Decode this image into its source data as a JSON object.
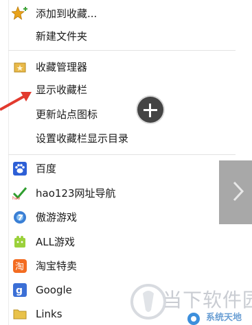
{
  "menu": {
    "add_to_favorites": "添加到收藏...",
    "new_folder": "新建文件夹",
    "favorites_manager": "收藏管理器",
    "show_favorites_bar": "显示收藏栏",
    "update_site_icons": "更新站点图标",
    "set_favorites_bar_dir": "设置收藏栏显示目录"
  },
  "bookmarks": [
    {
      "label": "百度",
      "icon": "baidu-paw-icon"
    },
    {
      "label": "hao123网址导航",
      "icon": "hao123-icon"
    },
    {
      "label": "傲游游戏",
      "icon": "maxthon-games-icon"
    },
    {
      "label": "ALL游戏",
      "icon": "all-games-icon"
    },
    {
      "label": "淘宝特卖",
      "icon": "taobao-icon"
    },
    {
      "label": "Google",
      "icon": "google-icon"
    },
    {
      "label": "Links",
      "icon": "folder-icon"
    }
  ],
  "watermark": {
    "text": "当下软件园",
    "sub": "系统天地"
  },
  "colors": {
    "separator": "#e2e2e2",
    "arrow": "#e23a2e",
    "side_panel": "#a8a8a8"
  }
}
